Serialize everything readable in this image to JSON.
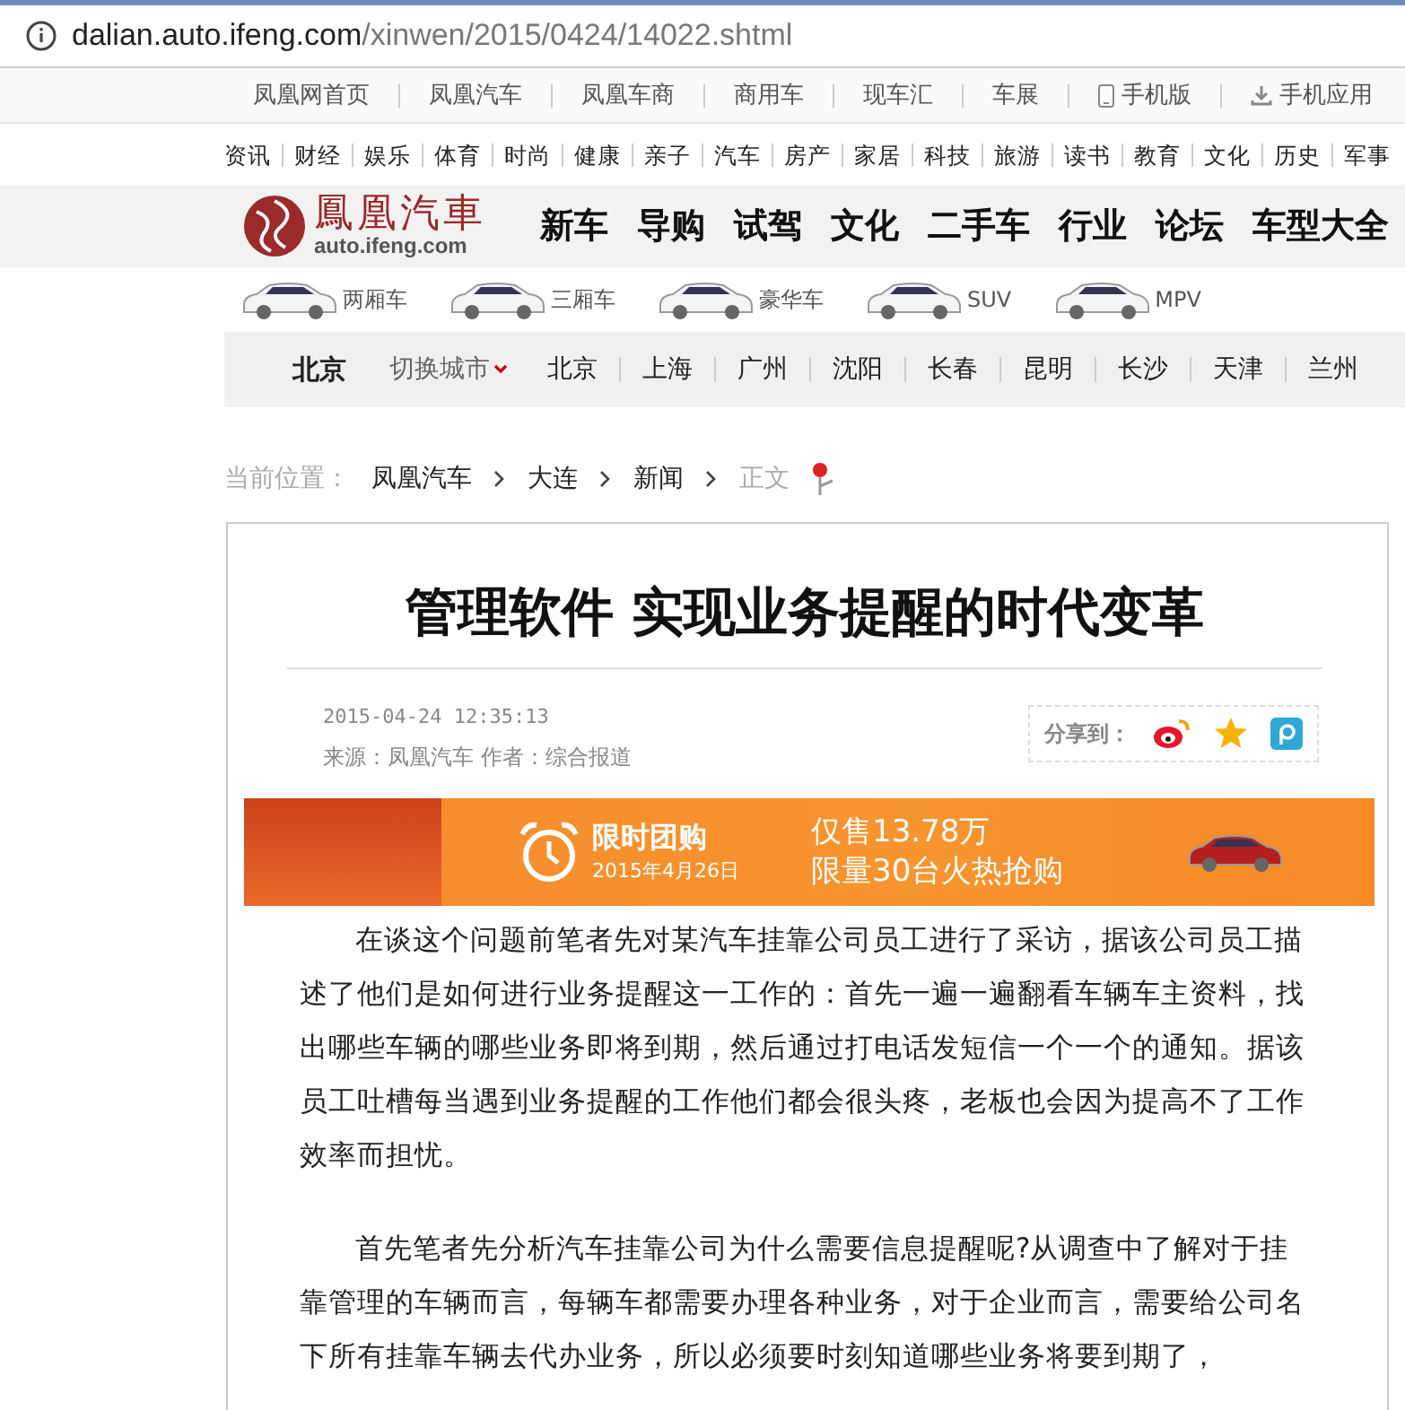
{
  "address_bar": {
    "host": "dalian.auto.ifeng.com",
    "path": "/xinwen/2015/0424/14022.shtml"
  },
  "top_links": [
    {
      "label": "凤凰网首页",
      "kind": "plain"
    },
    {
      "label": "凤凰汽车",
      "kind": "plain"
    },
    {
      "label": "凤凰车商",
      "kind": "plain"
    },
    {
      "label": "商用车",
      "kind": "plain"
    },
    {
      "label": "现车汇",
      "kind": "plain"
    },
    {
      "label": "车展",
      "kind": "plain"
    },
    {
      "label": "手机版",
      "kind": "phone"
    },
    {
      "label": "手机应用",
      "kind": "download"
    }
  ],
  "channels": [
    "资讯",
    "财经",
    "娱乐",
    "体育",
    "时尚",
    "健康",
    "亲子",
    "汽车",
    "房产",
    "家居",
    "科技",
    "旅游",
    "读书",
    "教育",
    "文化",
    "历史",
    "军事"
  ],
  "logo": {
    "name": "鳳凰汽車",
    "domain": "auto.ifeng.com"
  },
  "main_nav": [
    "新车",
    "导购",
    "试驾",
    "文化",
    "二手车",
    "行业",
    "论坛",
    "车型大全"
  ],
  "car_types": [
    "两厢车",
    "三厢车",
    "豪华车",
    "SUV",
    "MPV"
  ],
  "city_bar": {
    "current": "北京",
    "switch": "切换城市",
    "cities": [
      "北京",
      "上海",
      "广州",
      "沈阳",
      "长春",
      "昆明",
      "长沙",
      "天津",
      "兰州"
    ]
  },
  "breadcrumb": {
    "label": "当前位置：",
    "items": [
      {
        "text": "凤凰汽车",
        "current": false
      },
      {
        "text": "大连",
        "current": false
      },
      {
        "text": "新闻",
        "current": false
      },
      {
        "text": "正文",
        "current": true
      }
    ]
  },
  "article": {
    "title": "管理软件 实现业务提醒的时代变革",
    "date": "2015-04-24 12:35:13",
    "source": "来源：凤凰汽车 作者：综合报道",
    "share_label": "分享到：",
    "banner": {
      "promo": "限时团购",
      "promo_date": "2015年4月26日",
      "price": "仅售13.78万",
      "limit": "限量30台火热抢购"
    },
    "paragraphs": [
      "在谈这个问题前笔者先对某汽车挂靠公司员工进行了采访，据该公司员工描述了他们是如何进行业务提醒这一工作的：首先一遍一遍翻看车辆车主资料，找出哪些车辆的哪些业务即将到期，然后通过打电话发短信一个一个的通知。据该员工吐槽每当遇到业务提醒的工作他们都会很头疼，老板也会因为提高不了工作效率而担忧。",
      "首先笔者先分析汽车挂靠公司为什么需要信息提醒呢?从调查中了解对于挂靠管理的车辆而言，每辆车都需要办理各种业务，对于企业而言，需要给公司名下所有挂靠车辆去代办业务，所以必须要时刻知道哪些业务将要到期了，"
    ]
  }
}
